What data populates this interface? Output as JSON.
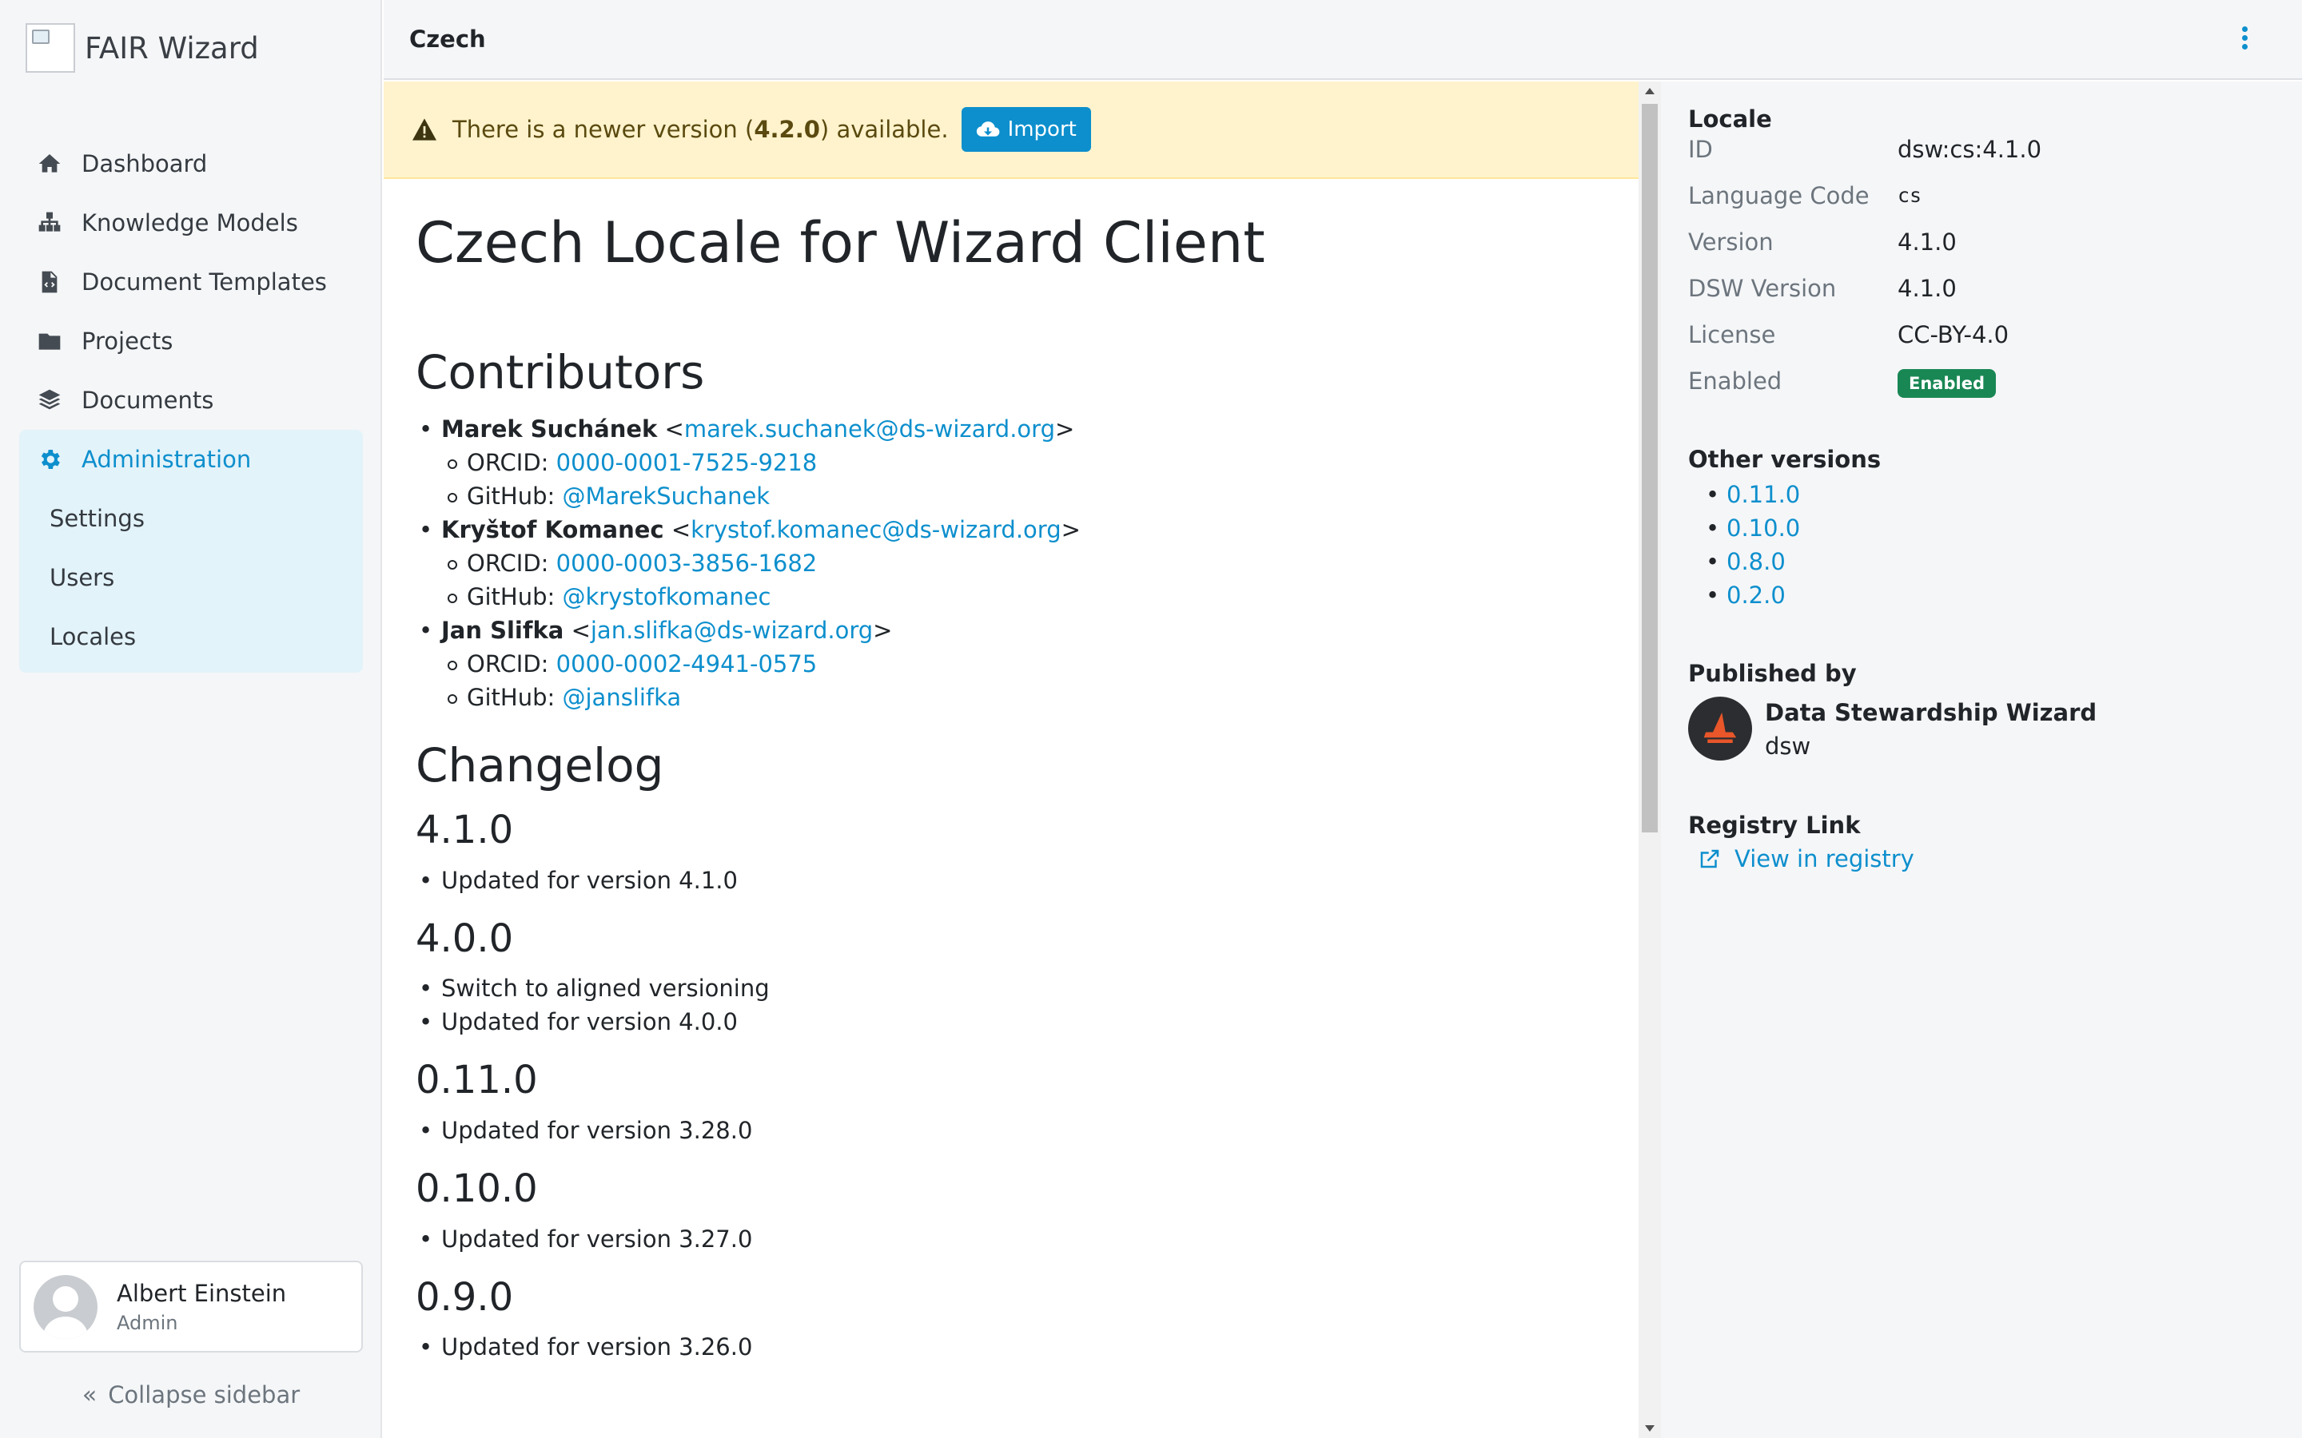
{
  "app": {
    "name": "FAIR Wizard"
  },
  "sidebar": {
    "items": [
      {
        "label": "Dashboard",
        "icon": "home-icon"
      },
      {
        "label": "Knowledge Models",
        "icon": "sitemap-icon"
      },
      {
        "label": "Document Templates",
        "icon": "file-code-icon"
      },
      {
        "label": "Projects",
        "icon": "folder-icon"
      },
      {
        "label": "Documents",
        "icon": "layers-icon"
      }
    ],
    "admin": {
      "label": "Administration",
      "icon": "gear-icon",
      "children": [
        "Settings",
        "Users",
        "Locales"
      ]
    },
    "profile": {
      "name": "Albert Einstein",
      "role": "Admin"
    },
    "collapse_label": "Collapse sidebar"
  },
  "topbar": {
    "title": "Czech"
  },
  "alert": {
    "prefix": "There is a newer version (",
    "version": "4.2.0",
    "suffix": ") available.",
    "button": "Import"
  },
  "readme": {
    "title": "Czech Locale for Wizard Client",
    "contributors_heading": "Contributors",
    "contributors": [
      {
        "name": "Marek Suchánek",
        "email": "marek.suchanek@ds-wizard.org",
        "orcid": "0000-0001-7525-9218",
        "github": "@MarekSuchanek"
      },
      {
        "name": "Kryštof Komanec",
        "email": "krystof.komanec@ds-wizard.org",
        "orcid": "0000-0003-3856-1682",
        "github": "@krystofkomanec"
      },
      {
        "name": "Jan Slifka",
        "email": "jan.slifka@ds-wizard.org",
        "orcid": "0000-0002-4941-0575",
        "github": "@janslifka"
      }
    ],
    "orcid_label": "ORCID:",
    "github_label": "GitHub:",
    "lt": "<",
    "gt": ">",
    "changelog_heading": "Changelog",
    "changelog": [
      {
        "version": "4.1.0",
        "notes": [
          "Updated for version 4.1.0"
        ]
      },
      {
        "version": "4.0.0",
        "notes": [
          "Switch to aligned versioning",
          "Updated for version 4.0.0"
        ]
      },
      {
        "version": "0.11.0",
        "notes": [
          "Updated for version 3.28.0"
        ]
      },
      {
        "version": "0.10.0",
        "notes": [
          "Updated for version 3.27.0"
        ]
      },
      {
        "version": "0.9.0",
        "notes": [
          "Updated for version 3.26.0"
        ]
      }
    ]
  },
  "detail": {
    "heading": "Locale",
    "fields": {
      "id": {
        "label": "ID",
        "value": "dsw:cs:4.1.0"
      },
      "language_code": {
        "label": "Language Code",
        "value": "cs"
      },
      "version": {
        "label": "Version",
        "value": "4.1.0"
      },
      "dsw_version": {
        "label": "DSW Version",
        "value": "4.1.0"
      },
      "license": {
        "label": "License",
        "value": "CC-BY-4.0"
      },
      "enabled": {
        "label": "Enabled",
        "value": "Enabled"
      }
    },
    "other_versions_heading": "Other versions",
    "other_versions": [
      "0.11.0",
      "0.10.0",
      "0.8.0",
      "0.2.0"
    ],
    "published_by_heading": "Published by",
    "publisher": {
      "name": "Data Stewardship Wizard",
      "id": "dsw"
    },
    "registry_heading": "Registry Link",
    "registry_link": "View in registry"
  },
  "colors": {
    "accent": "#0d8fcd",
    "success": "#198754",
    "warning_bg": "#fff3cd"
  }
}
